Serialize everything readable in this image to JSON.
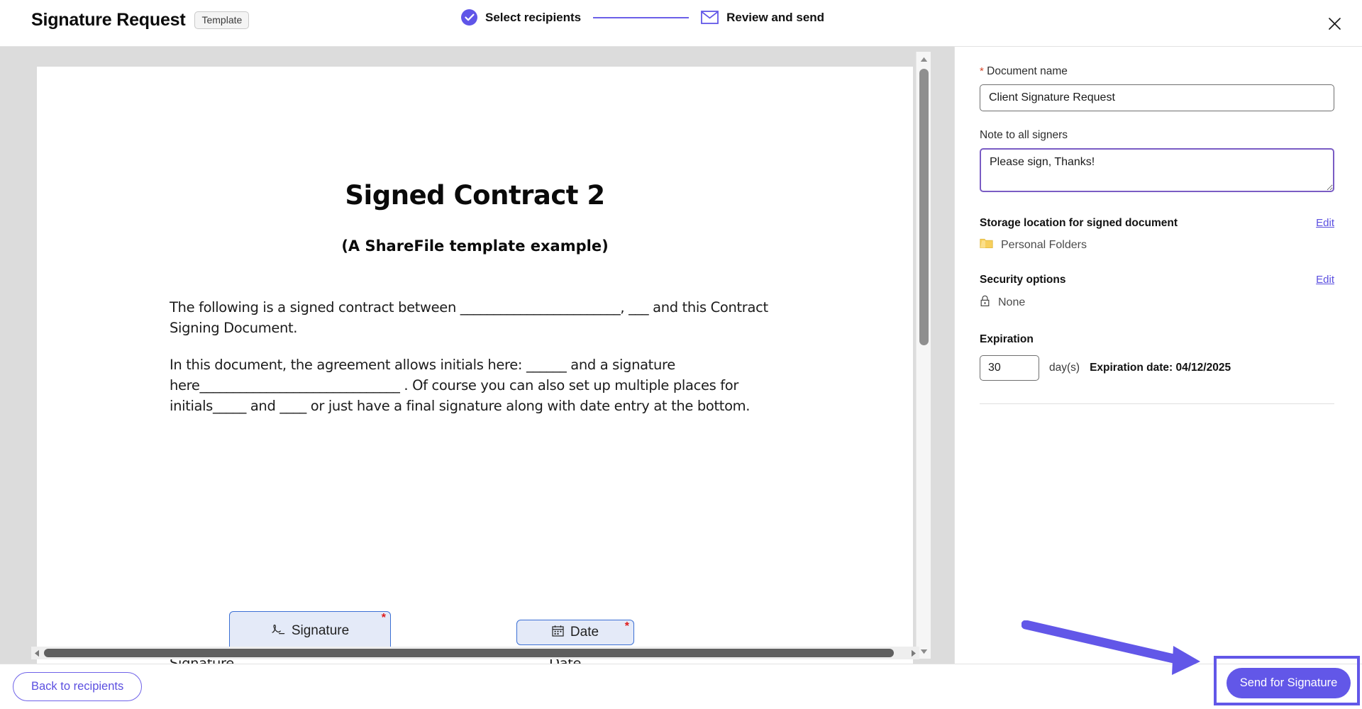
{
  "header": {
    "title": "Signature Request",
    "badge": "Template",
    "close_icon": "close-icon",
    "stepper": {
      "steps": [
        {
          "label": "Select recipients",
          "state": "complete",
          "icon": "check-circle-icon"
        },
        {
          "label": "Review and send",
          "state": "active",
          "icon": "mail-icon"
        }
      ]
    },
    "accent_color": "#6257e8"
  },
  "document": {
    "heading": "Signed Contract 2",
    "subheading": "(A ShareFile template example)",
    "paragraph_1": "The following is a signed contract between ________________________, ___ and this Contract Signing Document.",
    "paragraph_2": "In this document, the agreement allows initials here: ______ and a signature here______________________________ . Of course you can also set up multiple places for initials_____ and ____ or just have a final signature along with date entry at the bottom.",
    "signature_line_label": "Signature_________________________________________",
    "date_line_label": "Date___________________",
    "fields": [
      {
        "label": "Signature",
        "icon": "signature-pen-icon",
        "required": true,
        "required_mark": "*"
      },
      {
        "label": "Date",
        "icon": "calendar-icon",
        "required": true,
        "required_mark": "*"
      }
    ]
  },
  "panel": {
    "document_name": {
      "label": "Document name",
      "required_mark": "*",
      "value": "Client Signature Request",
      "placeholder": "Document name"
    },
    "note": {
      "label": "Note to all signers",
      "value": "Please sign, Thanks!",
      "placeholder": "Note to all signers"
    },
    "storage": {
      "title": "Storage location for signed document",
      "edit_label": "Edit",
      "value": "Personal Folders",
      "icon": "folder-icon"
    },
    "security": {
      "title": "Security options",
      "edit_label": "Edit",
      "value": "None",
      "icon": "lock-icon"
    },
    "expiration": {
      "title": "Expiration",
      "days_value": "30",
      "days_unit": "day(s)",
      "expiration_date": "Expiration date: 04/12/2025"
    }
  },
  "scrollbars": {
    "vertical": {
      "up_icon": "caret-up-icon",
      "down_icon": "caret-down-icon"
    },
    "horizontal": {
      "left_icon": "caret-left-icon",
      "right_icon": "caret-right-icon"
    }
  },
  "footer": {
    "back_label": "Back to recipients",
    "send_label": "Send for Signature",
    "highlight_color": "#6257e8"
  },
  "annotation": {
    "type": "arrow",
    "color": "#6257e8",
    "points_to": "send-for-signature-button"
  }
}
